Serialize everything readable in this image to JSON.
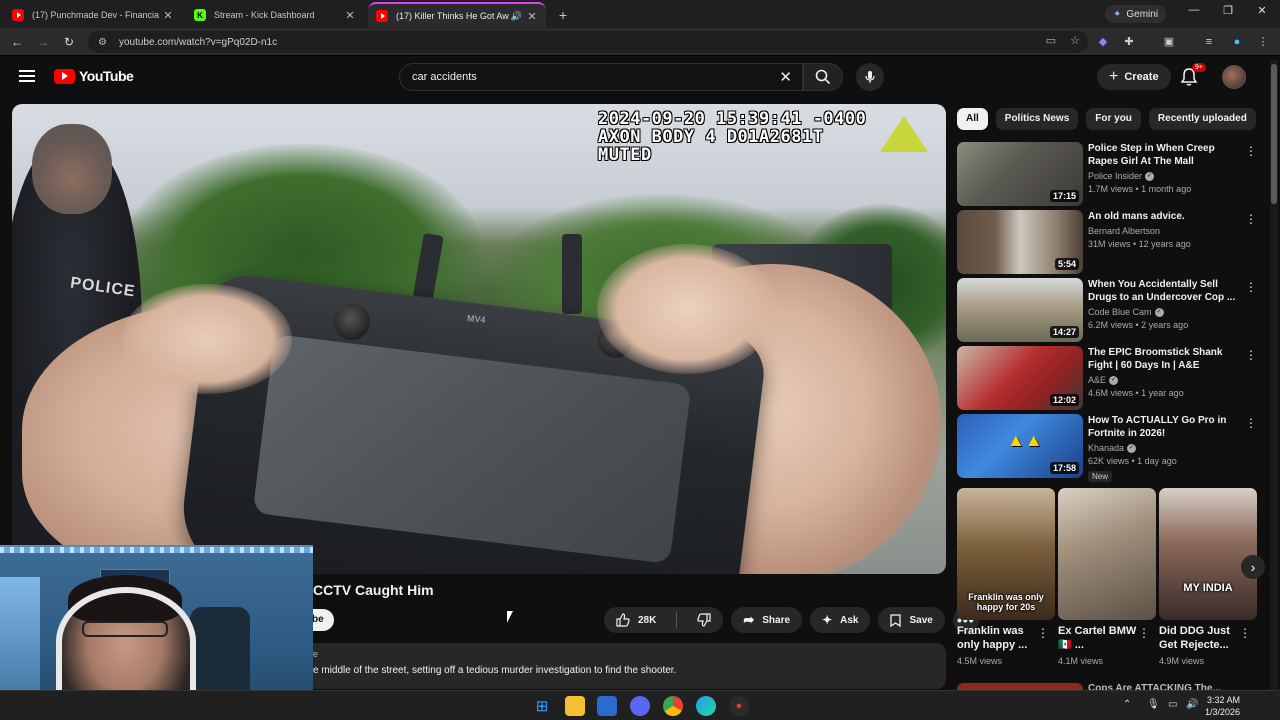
{
  "browser": {
    "tabs": [
      {
        "title": "(17) Punchmade Dev - Financia",
        "icon": "youtube-icon",
        "active": false
      },
      {
        "title": "Stream - Kick Dashboard",
        "icon": "kick-icon",
        "active": false
      },
      {
        "title": "(17) Killer Thinks He Got Aw",
        "icon": "youtube-icon",
        "active": true
      }
    ],
    "gemini_label": "Gemini",
    "url": "youtube.com/watch?v=gPq02D-n1c"
  },
  "youtube": {
    "logo_text": "YouTube",
    "search_value": "car accidents",
    "create_label": "Create",
    "notification_badge": "9+"
  },
  "video": {
    "osd_line1": "2024-09-20 15:39:41 -0400",
    "osd_line2": "AXON BODY 4 D01A2681T",
    "osd_line3": "MUTED",
    "police_text": "POLICE",
    "controller_brand": "MV4",
    "title_visible": "CCTV Caught Him",
    "subscribe_label": "be",
    "like_count": "28K",
    "share_label": "Share",
    "ask_label": "Ask",
    "save_label": "Save",
    "desc_line1": "e",
    "desc_line2": "e middle of the street, setting off a tedious murder investigation to find the shooter."
  },
  "chips": [
    "All",
    "Politics News",
    "For you",
    "Recently uploaded"
  ],
  "recommendations": [
    {
      "title": "Police Step in When Creep Rapes Girl At The Mall",
      "channel": "Police Insider",
      "verified": true,
      "views": "1.7M views • 1 month ago",
      "duration": "17:15",
      "new": false
    },
    {
      "title": "An old mans advice.",
      "channel": "Bernard Albertson",
      "verified": false,
      "views": "31M views • 12 years ago",
      "duration": "5:54",
      "new": false
    },
    {
      "title": "When You Accidentally Sell Drugs to an Undercover Cop ...",
      "channel": "Code Blue Cam",
      "verified": true,
      "views": "6.2M views • 2 years ago",
      "duration": "14:27",
      "new": false
    },
    {
      "title": "The EPIC Broomstick Shank Fight | 60 Days In | A&E",
      "channel": "A&E",
      "verified": true,
      "views": "4.6M views • 1 year ago",
      "duration": "12:02",
      "new": false
    },
    {
      "title": "How To ACTUALLY Go Pro in Fortnite in 2026!",
      "channel": "Khanada",
      "verified": true,
      "views": "62K views • 1 day ago",
      "duration": "17:58",
      "new": true,
      "new_label": "New"
    }
  ],
  "shorts": [
    {
      "title": "Franklin was only happy ...",
      "views": "4.5M views",
      "caption": "Franklin was only happy for 20s"
    },
    {
      "title": "Ex Cartel BMW 🇲🇽 ...",
      "views": "4.1M views",
      "caption": ""
    },
    {
      "title": "Did DDG Just Get Rejecte...",
      "views": "4.9M views",
      "caption": "MY INDIA"
    }
  ],
  "next_item_title": "Cops Are ATTACKING The...",
  "taskbar": {
    "time": "3:32 AM",
    "date": "1/3/2026"
  },
  "colors": {
    "bg": "#0f0f0f",
    "youtube_red": "#ff0000",
    "kick_green": "#53fc18",
    "chip_active": "#f1f1f1"
  }
}
